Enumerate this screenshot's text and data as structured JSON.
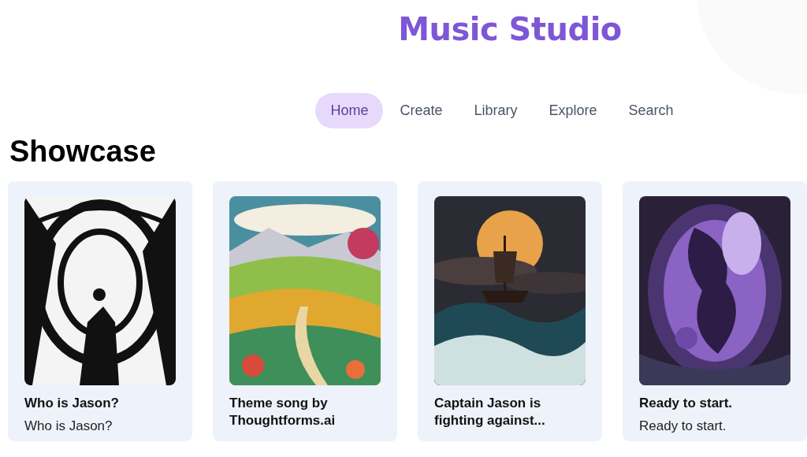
{
  "header": {
    "title": "Music Studio"
  },
  "nav": [
    {
      "label": "Home",
      "selected": true
    },
    {
      "label": "Create",
      "selected": false
    },
    {
      "label": "Library",
      "selected": false
    },
    {
      "label": "Explore",
      "selected": false
    },
    {
      "label": "Search",
      "selected": false
    }
  ],
  "section": {
    "title": "Showcase"
  },
  "cards": [
    {
      "title": "Who is Jason?",
      "description": "Who is Jason?"
    },
    {
      "title": "Theme song by Thoughtforms.ai"
    },
    {
      "title": "Captain Jason is fighting against..."
    },
    {
      "title": "Ready to start.",
      "description": "Ready to start."
    }
  ]
}
